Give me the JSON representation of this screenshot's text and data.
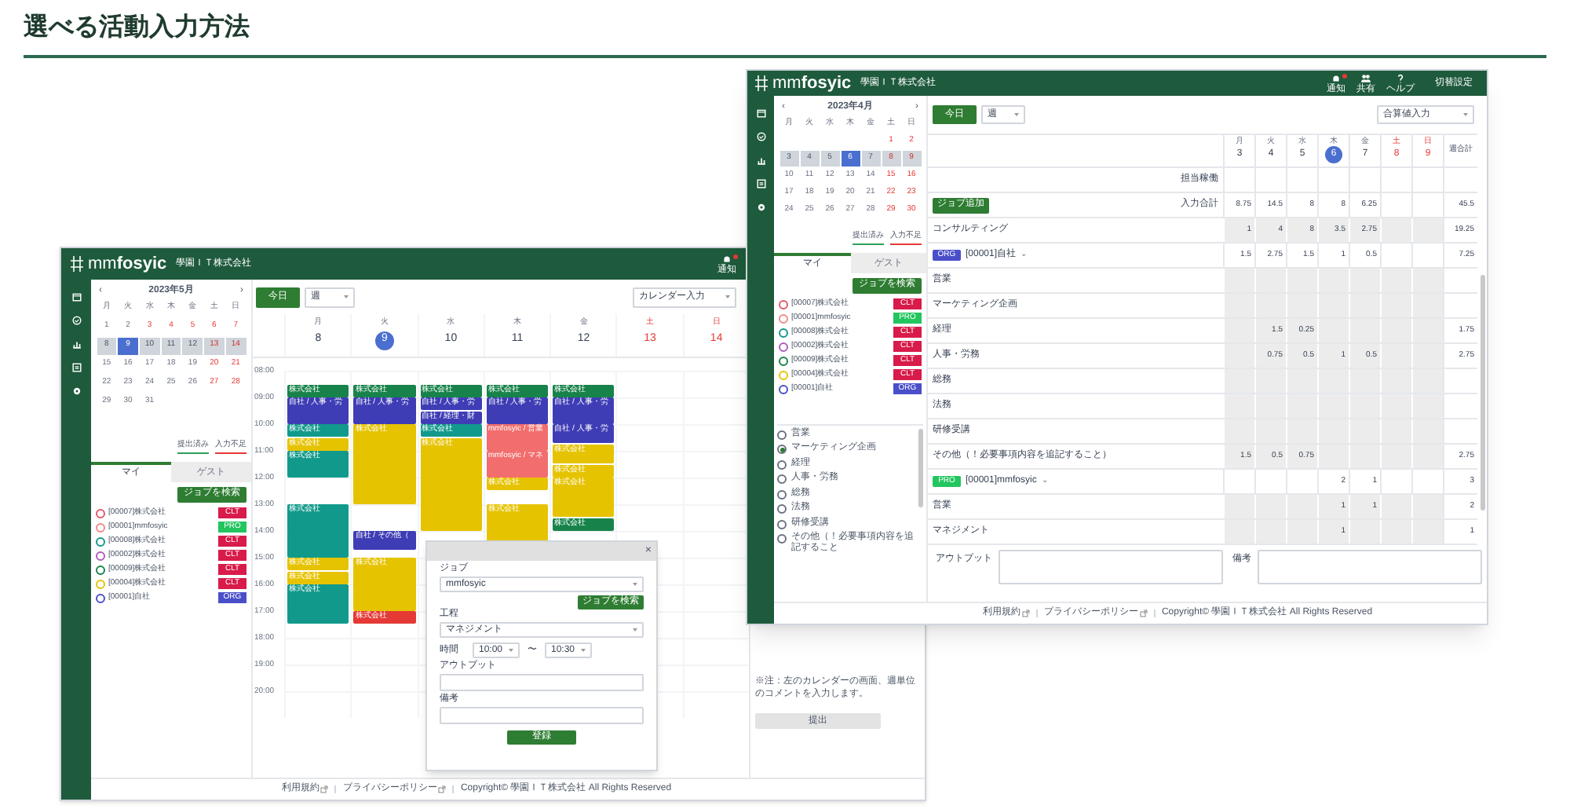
{
  "heading": "選べる活動入力方法",
  "calendar_window": {
    "header": {
      "brand": "mm**fosyic**",
      "company": "學園ＩＴ株式会社",
      "actions": [
        {
          "label": "通知",
          "badge": true
        }
      ]
    },
    "mini_calendar": {
      "prev": "‹",
      "month": "2023年5月",
      "next": "›",
      "weekdays": [
        "月",
        "火",
        "水",
        "木",
        "金",
        "土",
        "日"
      ],
      "weeks": [
        {
          "selected": false,
          "days": [
            {
              "day": "1",
              "holiday": false,
              "today": false
            },
            {
              "day": "2",
              "holiday": false,
              "today": false
            },
            {
              "day": "3",
              "holiday": true,
              "today": false
            },
            {
              "day": "4",
              "holiday": true,
              "today": false
            },
            {
              "day": "5",
              "holiday": true,
              "today": false
            },
            {
              "day": "6",
              "holiday": true,
              "today": false
            },
            {
              "day": "7",
              "holiday": true,
              "today": false
            }
          ]
        },
        {
          "selected": true,
          "days": [
            {
              "day": "8",
              "holiday": false,
              "today": false
            },
            {
              "day": "9",
              "holiday": false,
              "today": true
            },
            {
              "day": "10",
              "holiday": false,
              "today": false
            },
            {
              "day": "11",
              "holiday": false,
              "today": false
            },
            {
              "day": "12",
              "holiday": false,
              "today": false
            },
            {
              "day": "13",
              "holiday": true,
              "today": false
            },
            {
              "day": "14",
              "holiday": true,
              "today": false
            }
          ]
        },
        {
          "selected": false,
          "days": [
            {
              "day": "15",
              "holiday": false,
              "today": false
            },
            {
              "day": "16",
              "holiday": false,
              "today": false
            },
            {
              "day": "17",
              "holiday": false,
              "today": false
            },
            {
              "day": "18",
              "holiday": false,
              "today": false
            },
            {
              "day": "19",
              "holiday": false,
              "today": false
            },
            {
              "day": "20",
              "holiday": true,
              "today": false
            },
            {
              "day": "21",
              "holiday": true,
              "today": false
            }
          ]
        },
        {
          "selected": false,
          "days": [
            {
              "day": "22",
              "holiday": false,
              "today": false
            },
            {
              "day": "23",
              "holiday": false,
              "today": false
            },
            {
              "day": "24",
              "holiday": false,
              "today": false
            },
            {
              "day": "25",
              "holiday": false,
              "today": false
            },
            {
              "day": "26",
              "holiday": false,
              "today": false
            },
            {
              "day": "27",
              "holiday": true,
              "today": false
            },
            {
              "day": "28",
              "holiday": true,
              "today": false
            }
          ]
        },
        {
          "selected": false,
          "days": [
            {
              "day": "29",
              "holiday": false,
              "today": false
            },
            {
              "day": "30",
              "holiday": false,
              "today": false
            },
            {
              "day": "31",
              "holiday": false,
              "today": false
            }
          ]
        }
      ]
    },
    "legend": [
      {
        "label": "提出済み",
        "color": "#2e9e5b"
      },
      {
        "label": "入力不足",
        "color": "#e53935"
      }
    ],
    "tabs": [
      {
        "label": "マイ",
        "selected": true
      },
      {
        "label": "ゲスト",
        "selected": false
      }
    ],
    "job_search_button": "ジョブを検索",
    "jobs": [
      {
        "name": "[00007]株式会社",
        "color": "#e05a6a",
        "badge": {
          "label": "CLT",
          "color": "#d81b4a"
        }
      },
      {
        "name": "[00001]mmfosyic",
        "color": "#f08a8a",
        "badge": {
          "label": "PRO",
          "color": "#22c55e"
        }
      },
      {
        "name": "[00008]株式会社",
        "color": "#119a8b",
        "badge": {
          "label": "CLT",
          "color": "#d81b4a"
        }
      },
      {
        "name": "[00002]株式会社",
        "color": "#b05cc0",
        "badge": {
          "label": "CLT",
          "color": "#d81b4a"
        }
      },
      {
        "name": "[00009]株式会社",
        "color": "#17834a",
        "badge": {
          "label": "CLT",
          "color": "#d81b4a"
        }
      },
      {
        "name": "[00004]株式会社",
        "color": "#e6c300",
        "badge": {
          "label": "CLT",
          "color": "#d81b4a"
        }
      },
      {
        "name": "[00001]自社",
        "color": "#4a4fc9",
        "badge": {
          "label": "ORG",
          "color": "#4a4fc9"
        }
      }
    ],
    "toolbar": {
      "today": "今日",
      "view": "週",
      "mode": "カレンダー入力"
    },
    "times": [
      "08:00",
      "09:00",
      "10:00",
      "11:00",
      "12:00",
      "13:00",
      "14:00",
      "15:00",
      "16:00",
      "17:00",
      "18:00",
      "19:00",
      "20:00"
    ],
    "days": [
      {
        "weekday": "月",
        "date": "8",
        "today": false,
        "holiday": false,
        "events": [
          {
            "color": "#17834a",
            "label": "株式会社"
          },
          {
            "color": "#3f3db5",
            "label": "自社 / 人事・労"
          },
          {
            "color": "#119a8b",
            "label": "株式会社"
          },
          {
            "color": "#e6c300",
            "label": "株式会社"
          },
          {
            "color": "#119a8b",
            "label": "株式会社"
          },
          {
            "color": "#119a8b",
            "label": "株式会社"
          },
          {
            "color": "#e6c300",
            "label": "株式会社"
          },
          {
            "color": "#e6c300",
            "label": "株式会社"
          },
          {
            "color": "#119a8b",
            "label": "株式会社"
          }
        ]
      },
      {
        "weekday": "火",
        "date": "9",
        "today": true,
        "holiday": false,
        "events": [
          {
            "color": "#17834a",
            "label": "株式会社"
          },
          {
            "color": "#3f3db5",
            "label": "自社 / 人事・労"
          },
          {
            "color": "#e6c300",
            "label": "株式会社"
          },
          {
            "color": "#3f3db5",
            "label": "自社 / その他（"
          },
          {
            "color": "#e6c300",
            "label": "株式会社"
          },
          {
            "color": "#e53935",
            "label": "株式会社"
          }
        ]
      },
      {
        "weekday": "水",
        "date": "10",
        "today": false,
        "holiday": false,
        "events": [
          {
            "color": "#17834a",
            "label": "株式会社"
          },
          {
            "color": "#3f3db5",
            "label": "自社 / 人事・労"
          },
          {
            "color": "#3f3db5",
            "label": "自社 / 経理・財"
          },
          {
            "color": "#119a8b",
            "label": "株式会社"
          },
          {
            "color": "#e6c300",
            "label": "株式会社"
          }
        ]
      },
      {
        "weekday": "木",
        "date": "11",
        "today": false,
        "holiday": false,
        "events": [
          {
            "color": "#17834a",
            "label": "株式会社"
          },
          {
            "color": "#3f3db5",
            "label": "自社 / 人事・労"
          },
          {
            "color": "#f26d6d",
            "label": "mmfosyic / 営業"
          },
          {
            "color": "#f26d6d",
            "label": "mmfosyic / マネ"
          },
          {
            "color": "#e6c300",
            "label": "株式会社"
          },
          {
            "color": "#e6c300",
            "label": "株式会社"
          }
        ]
      },
      {
        "weekday": "金",
        "date": "12",
        "today": false,
        "holiday": false,
        "events": [
          {
            "color": "#17834a",
            "label": "株式会社"
          },
          {
            "color": "#3f3db5",
            "label": "自社 / 人事・労"
          },
          {
            "color": "#3f3db5",
            "label": "自社 / 人事・労"
          },
          {
            "color": "#e6c300",
            "label": "株式会社"
          },
          {
            "color": "#e6c300",
            "label": "株式会社"
          },
          {
            "color": "#e6c300",
            "label": "株式会社"
          },
          {
            "color": "#17834a",
            "label": "株式会社"
          }
        ]
      },
      {
        "weekday": "土",
        "date": "13",
        "today": false,
        "holiday": true
      },
      {
        "weekday": "日",
        "date": "14",
        "today": false,
        "holiday": true
      }
    ],
    "dialog": {
      "close": "×",
      "job_label": "ジョブ",
      "job_value": "mmfosyic",
      "search_button": "ジョブを検索",
      "process_label": "工程",
      "process_value": "マネジメント",
      "time_label": "時間",
      "time_from": "10:00",
      "time_sep": "〜",
      "time_to": "10:30",
      "output_label": "アウトプット",
      "note_label": "備考",
      "submit": "登録"
    },
    "side_note": "※注：左のカレンダーの画面、週単位のコメントを入力します。",
    "side_button": "提出",
    "footer": {
      "links": [
        {
          "label": "利用規約"
        },
        {
          "label": "プライバシーポリシー"
        }
      ],
      "copyright": "Copyright© 學園ＩＴ株式会社 All Rights Reserved"
    }
  },
  "table_window": {
    "header": {
      "brand": "mm**fosyic**",
      "company": "學園ＩＴ株式会社",
      "actions": [
        {
          "label": "通知",
          "badge": true
        },
        {
          "label": "共有",
          "badge": false
        },
        {
          "label": "ヘルプ",
          "badge": false
        }
      ],
      "user": "切替設定"
    },
    "mini_calendar": {
      "prev": "‹",
      "month": "2023年4月",
      "next": "›",
      "weekdays": [
        "月",
        "火",
        "水",
        "木",
        "金",
        "土",
        "日"
      ],
      "weeks": [
        {
          "selected": false,
          "days": [
            {
              "day": "1",
              "holiday": true,
              "today": false
            },
            {
              "day": "2",
              "holiday": true,
              "today": false
            }
          ]
        },
        {
          "selected": true,
          "days": [
            {
              "day": "3",
              "holiday": false,
              "today": false
            },
            {
              "day": "4",
              "holiday": false,
              "today": false
            },
            {
              "day": "5",
              "holiday": false,
              "today": false
            },
            {
              "day": "6",
              "holiday": false,
              "today": true
            },
            {
              "day": "7",
              "holiday": false,
              "today": false
            },
            {
              "day": "8",
              "holiday": true,
              "today": false
            },
            {
              "day": "9",
              "holiday": true,
              "today": false
            }
          ]
        },
        {
          "selected": false,
          "days": [
            {
              "day": "10",
              "holiday": false,
              "today": false
            },
            {
              "day": "11",
              "holiday": false,
              "today": false
            },
            {
              "day": "12",
              "holiday": false,
              "today": false
            },
            {
              "day": "13",
              "holiday": false,
              "today": false
            },
            {
              "day": "14",
              "holiday": false,
              "today": false
            },
            {
              "day": "15",
              "holiday": true,
              "today": false
            },
            {
              "day": "16",
              "holiday": true,
              "today": false
            }
          ]
        },
        {
          "selected": false,
          "days": [
            {
              "day": "17",
              "holiday": false,
              "today": false
            },
            {
              "day": "18",
              "holiday": false,
              "today": false
            },
            {
              "day": "19",
              "holiday": false,
              "today": false
            },
            {
              "day": "20",
              "holiday": false,
              "today": false
            },
            {
              "day": "21",
              "holiday": false,
              "today": false
            },
            {
              "day": "22",
              "holiday": true,
              "today": false
            },
            {
              "day": "23",
              "holiday": true,
              "today": false
            }
          ]
        },
        {
          "selected": false,
          "days": [
            {
              "day": "24",
              "holiday": false,
              "today": false
            },
            {
              "day": "25",
              "holiday": false,
              "today": false
            },
            {
              "day": "26",
              "holiday": false,
              "today": false
            },
            {
              "day": "27",
              "holiday": false,
              "today": false
            },
            {
              "day": "28",
              "holiday": false,
              "today": false
            },
            {
              "day": "29",
              "holiday": true,
              "today": false
            },
            {
              "day": "30",
              "holiday": true,
              "today": false
            }
          ]
        }
      ]
    },
    "legend": [
      {
        "label": "提出済み",
        "color": "#2e9e5b"
      },
      {
        "label": "入力不足",
        "color": "#e53935"
      }
    ],
    "tabs": [
      {
        "label": "マイ",
        "selected": true
      },
      {
        "label": "ゲスト",
        "selected": false
      }
    ],
    "job_search_button": "ジョブを検索",
    "jobs": [
      {
        "name": "[00007]株式会社",
        "color": "#e05a6a",
        "badge": {
          "label": "CLT",
          "color": "#d81b4a"
        }
      },
      {
        "name": "[00001]mmfosyic",
        "color": "#f08a8a",
        "badge": {
          "label": "PRO",
          "color": "#22c55e"
        }
      },
      {
        "name": "[00008]株式会社",
        "color": "#119a8b",
        "badge": {
          "label": "CLT",
          "color": "#d81b4a"
        }
      },
      {
        "name": "[00002]株式会社",
        "color": "#b05cc0",
        "badge": {
          "label": "CLT",
          "color": "#d81b4a"
        }
      },
      {
        "name": "[00009]株式会社",
        "color": "#17834a",
        "badge": {
          "label": "CLT",
          "color": "#d81b4a"
        }
      },
      {
        "name": "[00004]株式会社",
        "color": "#e6c300",
        "badge": {
          "label": "CLT",
          "color": "#d81b4a"
        }
      },
      {
        "name": "[00001]自社",
        "color": "#4a4fc9",
        "badge": {
          "label": "ORG",
          "color": "#4a4fc9"
        }
      }
    ],
    "processes": [
      {
        "label": "営業",
        "selected": false
      },
      {
        "label": "マーケティング企画",
        "selected": true
      },
      {
        "label": "経理",
        "selected": false
      },
      {
        "label": "人事・労務",
        "selected": false
      },
      {
        "label": "総務",
        "selected": false
      },
      {
        "label": "法務",
        "selected": false
      },
      {
        "label": "研修受講",
        "selected": false
      },
      {
        "label": "その他（！必要事項内容を追記すること",
        "selected": false
      }
    ],
    "toolbar": {
      "today": "今日",
      "view": "週",
      "mode": "合算値入力"
    },
    "days": [
      {
        "weekday": "月",
        "date": "3",
        "today": false,
        "holiday": false
      },
      {
        "weekday": "火",
        "date": "4",
        "today": false,
        "holiday": false
      },
      {
        "weekday": "水",
        "date": "5",
        "today": false,
        "holiday": false
      },
      {
        "weekday": "木",
        "date": "6",
        "today": true,
        "holiday": false
      },
      {
        "weekday": "金",
        "date": "7",
        "today": false,
        "holiday": false
      },
      {
        "weekday": "土",
        "date": "8",
        "today": false,
        "holiday": true
      },
      {
        "weekday": "日",
        "date": "9",
        "today": false,
        "holiday": true
      }
    ],
    "total_header": "週合計",
    "rows": [
      {
        "kind": "summary",
        "label": "担当稼働"
      },
      {
        "kind": "summary",
        "label": "入力合計",
        "button": "ジョブ追加",
        "values": {
          "mon": "8.75",
          "tue": "14.5",
          "wed": "8",
          "thu": "8",
          "fri": "6.25"
        },
        "total": "45.5"
      },
      {
        "kind": "task",
        "label": "コンサルティング",
        "values": {
          "mon": "1",
          "tue": "4",
          "wed": "8",
          "thu": "3.5",
          "fri": "2.75"
        },
        "total": "19.25"
      },
      {
        "kind": "job",
        "badge": {
          "label": "ORG",
          "color": "#4a4fc9"
        },
        "label": "[00001]自社",
        "caret": "⌄",
        "values": {
          "mon": "1.5",
          "tue": "2.75",
          "wed": "1.5",
          "thu": "1",
          "fri": "0.5"
        },
        "total": "7.25"
      },
      {
        "kind": "task",
        "label": "営業"
      },
      {
        "kind": "task",
        "label": "マーケティング企画"
      },
      {
        "kind": "task",
        "label": "経理",
        "values": {
          "tue": "1.5",
          "wed": "0.25"
        },
        "total": "1.75"
      },
      {
        "kind": "task",
        "label": "人事・労務",
        "values": {
          "tue": "0.75",
          "wed": "0.5",
          "thu": "1",
          "fri": "0.5"
        },
        "total": "2.75"
      },
      {
        "kind": "task",
        "label": "総務"
      },
      {
        "kind": "task",
        "label": "法務"
      },
      {
        "kind": "task",
        "label": "研修受講"
      },
      {
        "kind": "task",
        "label": "その他（！必要事項内容を追記すること）",
        "values": {
          "mon": "1.5",
          "tue": "0.5",
          "wed": "0.75"
        },
        "total": "2.75"
      },
      {
        "kind": "job",
        "badge": {
          "label": "PRO",
          "color": "#22c55e"
        },
        "label": "[00001]mmfosyic",
        "caret": "⌄",
        "values": {
          "thu": "2",
          "fri": "1"
        },
        "total": "3"
      },
      {
        "kind": "task",
        "label": "営業",
        "values": {
          "thu": "1",
          "fri": "1"
        },
        "total": "2"
      },
      {
        "kind": "task",
        "label": "マネジメント",
        "values": {
          "thu": "1"
        },
        "total": "1"
      }
    ],
    "output_label": "アウトプット",
    "note_label": "備考",
    "footer": {
      "links": [
        {
          "label": "利用規約"
        },
        {
          "label": "プライバシーポリシー"
        }
      ],
      "copyright": "Copyright© 學園ＩＴ株式会社 All Rights Reserved"
    }
  }
}
